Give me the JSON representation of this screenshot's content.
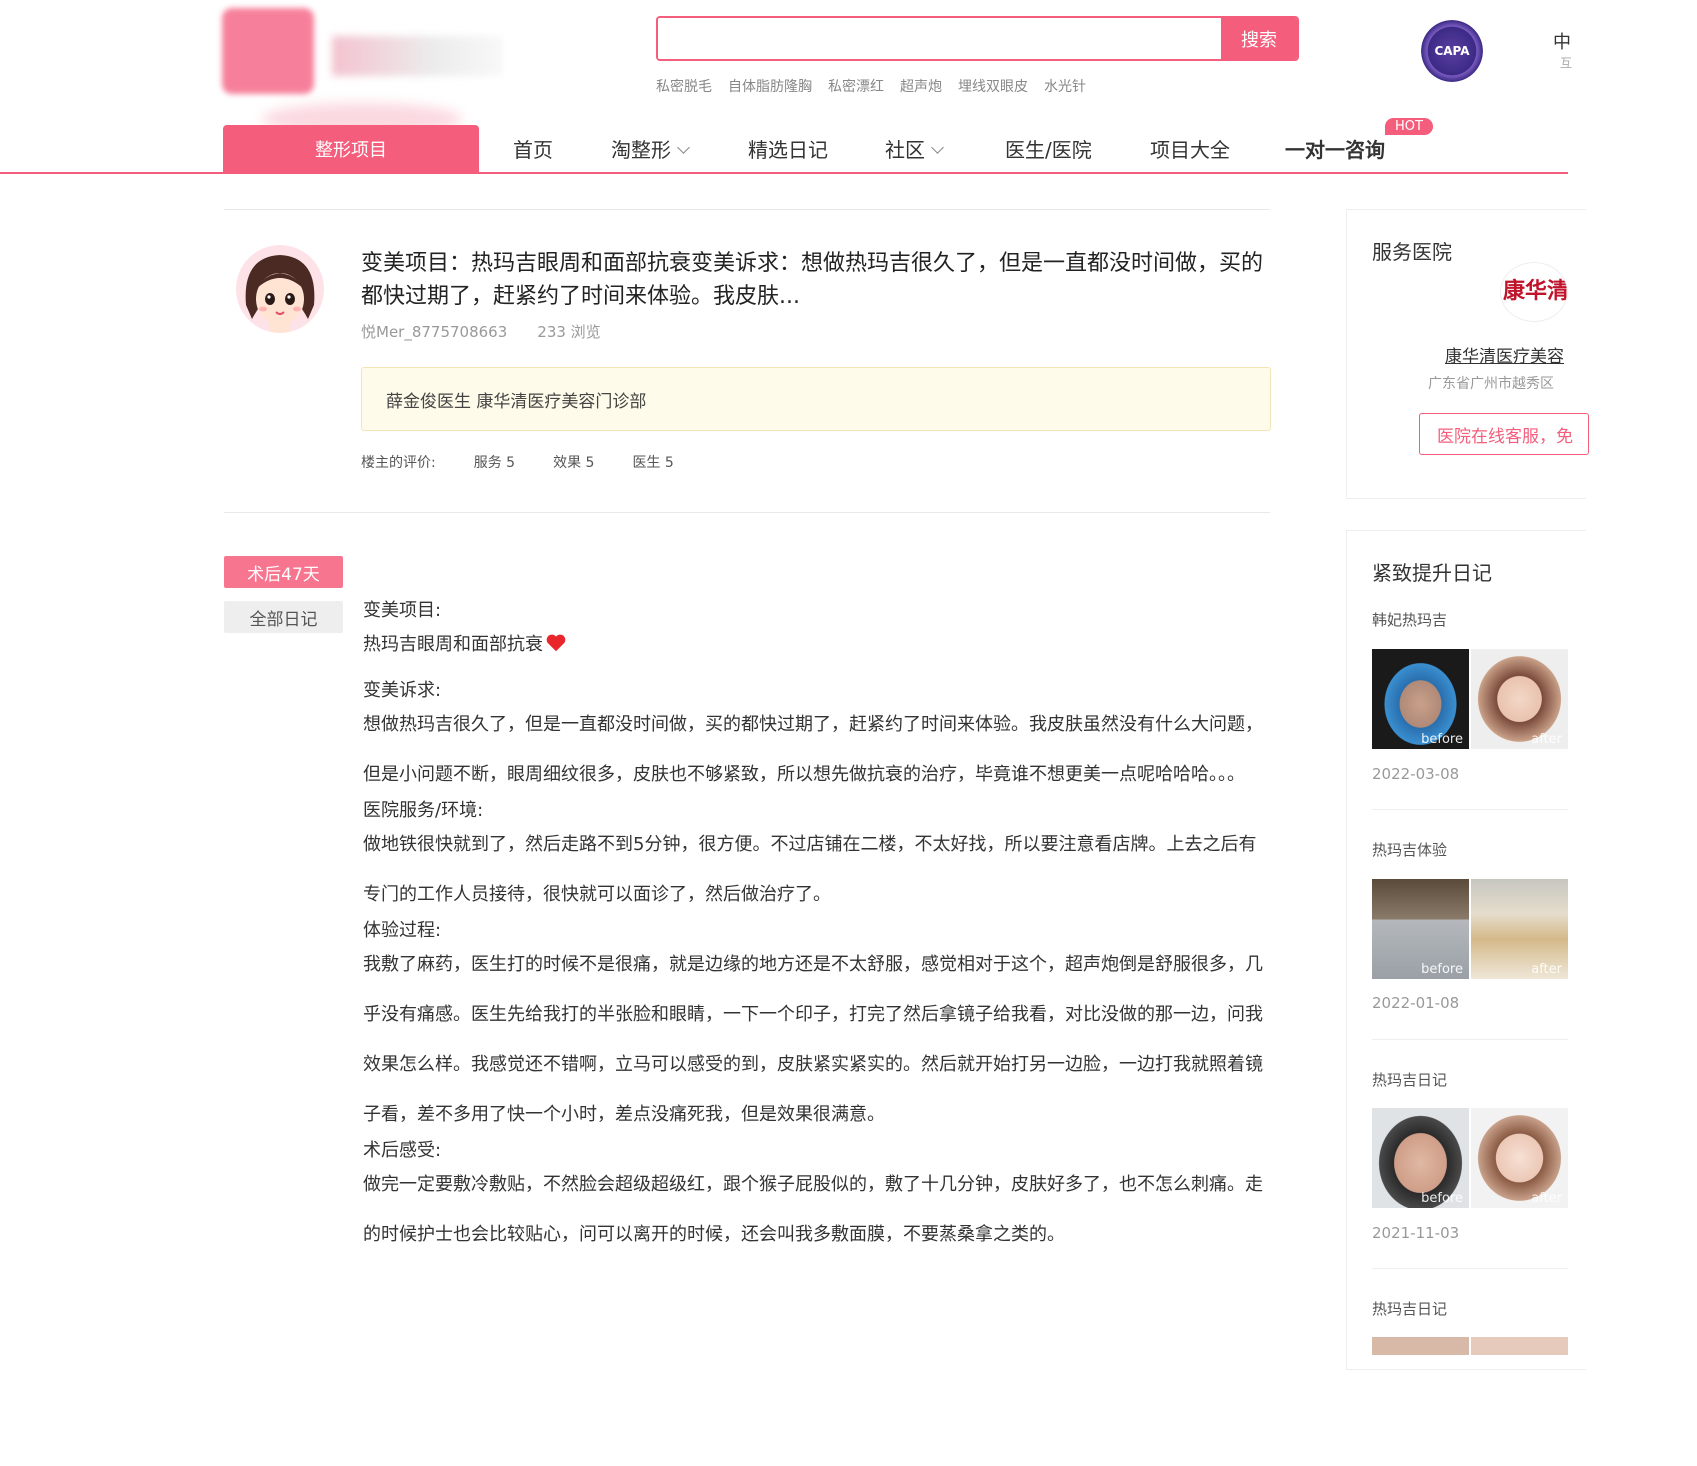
{
  "header": {
    "search_placeholder": "",
    "search_button": "搜索",
    "hot_words": [
      "私密脱毛",
      "自体脂肪隆胸",
      "私密漂红",
      "超声炮",
      "埋线双眼皮",
      "水光针"
    ],
    "badge_label": "CAPA",
    "right_text": "中",
    "right_subtext": "互"
  },
  "nav": {
    "active": "整形项目",
    "items": [
      "首页",
      "淘整形",
      "精选日记",
      "社区",
      "医生/医院",
      "项目大全",
      "一对一咨询"
    ],
    "hot_badge": "HOT"
  },
  "post": {
    "title": "变美项目：热玛吉眼周和面部抗衰变美诉求：想做热玛吉很久了，但是一直都没时间做，买的都快过期了，赶紧约了时间来体验。我皮肤...",
    "author": "悦Mer_8775708663",
    "views": "233 浏览",
    "doctor_hospital": "薛金俊医生 康华清医疗美容门诊部",
    "rating_label": "楼主的评价:",
    "ratings": [
      "服务 5",
      "效果 5",
      "医生 5"
    ]
  },
  "diary": {
    "days_badge": "术后47天",
    "all_diary": "全部日记",
    "sections": [
      {
        "heading": "变美项目:",
        "text": "热玛吉眼周和面部抗衰"
      },
      {
        "heading": "变美诉求:",
        "text": "想做热玛吉很久了，但是一直都没时间做，买的都快过期了，赶紧约了时间来体验。我皮肤虽然没有什么大问题，但是小问题不断，眼周细纹很多，皮肤也不够紧致，所以想先做抗衰的治疗，毕竟谁不想更美一点呢哈哈哈。。。"
      },
      {
        "heading": "医院服务/环境:",
        "text": "做地铁很快就到了，然后走路不到5分钟，很方便。不过店铺在二楼，不太好找，所以要注意看店牌。上去之后有专门的工作人员接待，很快就可以面诊了，然后做治疗了。"
      },
      {
        "heading": "体验过程:",
        "text": "我敷了麻药，医生打的时候不是很痛，就是边缘的地方还是不太舒服，感觉相对于这个，超声炮倒是舒服很多，几乎没有痛感。医生先给我打的半张脸和眼睛，一下一个印子，打完了然后拿镜子给我看，对比没做的那一边，问我效果怎么样。我感觉还不错啊，立马可以感受的到，皮肤紧实紧实的。然后就开始打另一边脸，一边打我就照着镜子看，差不多用了快一个小时，差点没痛死我，但是效果很满意。"
      },
      {
        "heading": "术后感受:",
        "text": "做完一定要敷冷敷贴，不然脸会超级超级红，跟个猴子屁股似的，敷了十几分钟，皮肤好多了，也不怎么刺痛。走的时候护士也会比较贴心，问可以离开的时候，还会叫我多敷面膜，不要蒸桑拿之类的。"
      }
    ]
  },
  "sidebar": {
    "hospital_title": "服务医院",
    "hospital_logo_text": "康华清",
    "hospital_name": "康华清医疗美容",
    "hospital_address": "广东省广州市越秀区",
    "hospital_button": "医院在线客服，免",
    "diary_title": "紧致提升日记",
    "diaries": [
      {
        "title": "韩妃热玛吉",
        "date": "2022-03-08",
        "before": "before",
        "after": "after"
      },
      {
        "title": "热玛吉体验",
        "date": "2022-01-08",
        "before": "before",
        "after": "after"
      },
      {
        "title": "热玛吉日记",
        "date": "2021-11-03",
        "before": "before",
        "after": "after"
      },
      {
        "title": "热玛吉日记",
        "date": "",
        "before": "",
        "after": ""
      }
    ]
  },
  "colors": {
    "accent": "#f45e7c",
    "notice_bg": "#fffbea"
  }
}
